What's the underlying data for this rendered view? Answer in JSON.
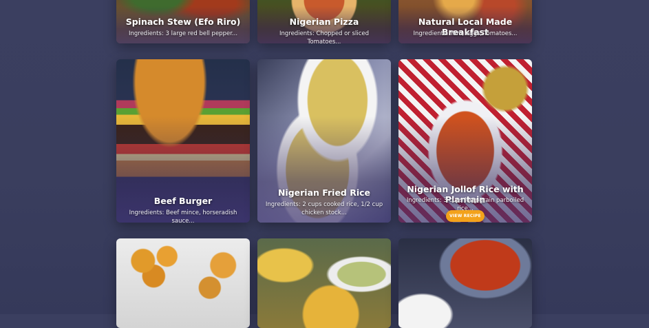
{
  "recipes": [
    {
      "title": "Spinach Stew (Efo Riro)",
      "ingredients": "Ingredients: 3 large red bell pepper..."
    },
    {
      "title": "Nigerian Pizza",
      "ingredients": "Ingredients: Chopped or sliced Tomatoes..."
    },
    {
      "title": "Natural Local Made Breakfast",
      "ingredients": "Ingredients: Yam, eggs, Tomatoes..."
    },
    {
      "title": "Beef Burger",
      "ingredients": "Ingredients: Beef mince, horseradish sauce..."
    },
    {
      "title": "Nigerian Fried Rice",
      "ingredients": "Ingredients: 2 cups cooked rice, 1/2 cup chicken stock..."
    },
    {
      "title": "Nigerian Jollof Rice with Plantain",
      "ingredients": "Ingredients: 3 cups long-grain parboiled rice...",
      "button": "VIEW RECIPE"
    }
  ],
  "colors": {
    "background": "#3a3e5e",
    "button": "#f3a21b"
  },
  "bottom_row_images": [
    "puff-puff-image",
    "plantain-image",
    "stew-image"
  ]
}
